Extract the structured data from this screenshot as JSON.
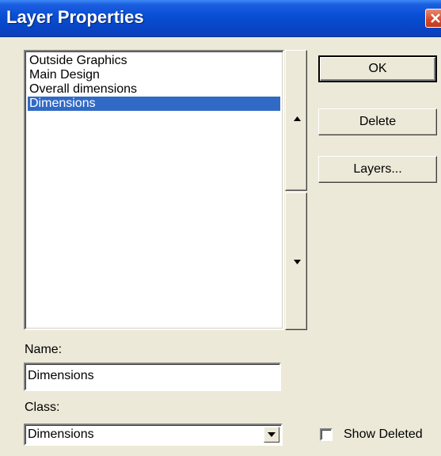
{
  "window": {
    "title": "Layer Properties"
  },
  "layers_list": {
    "items": [
      {
        "label": "Outside Graphics",
        "selected": false
      },
      {
        "label": "Main Design",
        "selected": false
      },
      {
        "label": "Overall dimensions",
        "selected": false
      },
      {
        "label": "Dimensions",
        "selected": true
      }
    ],
    "move_up_icon": "triangle-up-icon",
    "move_down_icon": "triangle-down-icon"
  },
  "buttons": {
    "ok": "OK",
    "delete": "Delete",
    "layers": "Layers..."
  },
  "name_field": {
    "label": "Name:",
    "value": "Dimensions"
  },
  "class_field": {
    "label": "Class:",
    "value": "Dimensions",
    "dropdown_icon": "chevron-down-icon"
  },
  "show_deleted": {
    "label": "Show Deleted",
    "checked": false
  },
  "colors": {
    "selection": "#316ac5",
    "titlebar": "#0a4fd6",
    "dialog_bg": "#ece9d8"
  }
}
